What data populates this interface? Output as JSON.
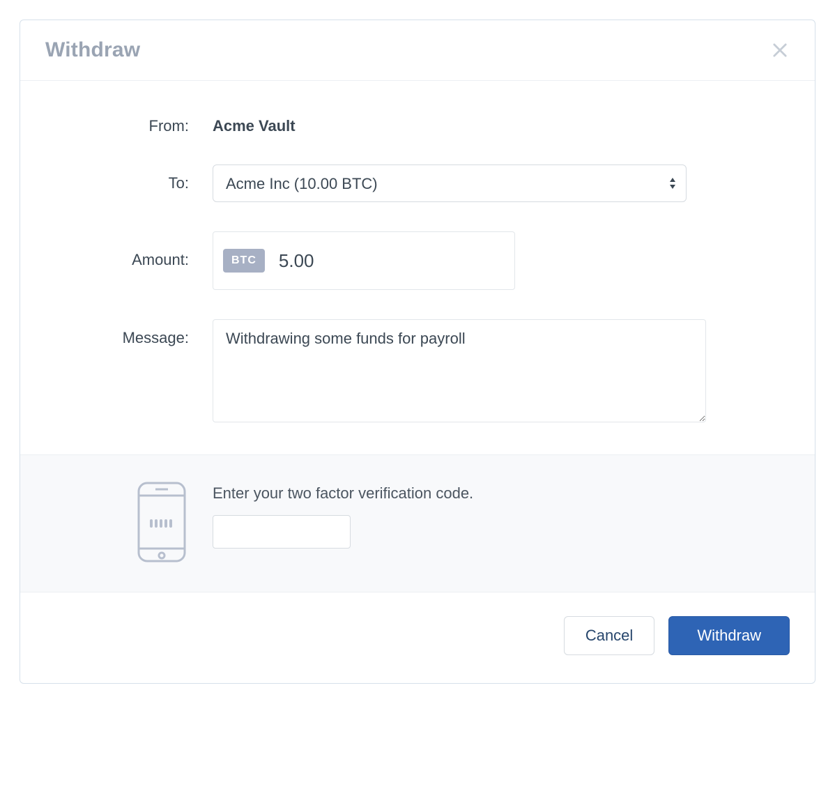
{
  "modal": {
    "title": "Withdraw"
  },
  "form": {
    "from_label": "From:",
    "from_value": "Acme Vault",
    "to_label": "To:",
    "to_selected": "Acme Inc (10.00 BTC)",
    "amount_label": "Amount:",
    "amount_currency": "BTC",
    "amount_value": "5.00",
    "message_label": "Message:",
    "message_value": "Withdrawing some funds for payroll"
  },
  "twofa": {
    "prompt": "Enter your two factor verification code.",
    "code_value": ""
  },
  "footer": {
    "cancel_label": "Cancel",
    "submit_label": "Withdraw"
  }
}
